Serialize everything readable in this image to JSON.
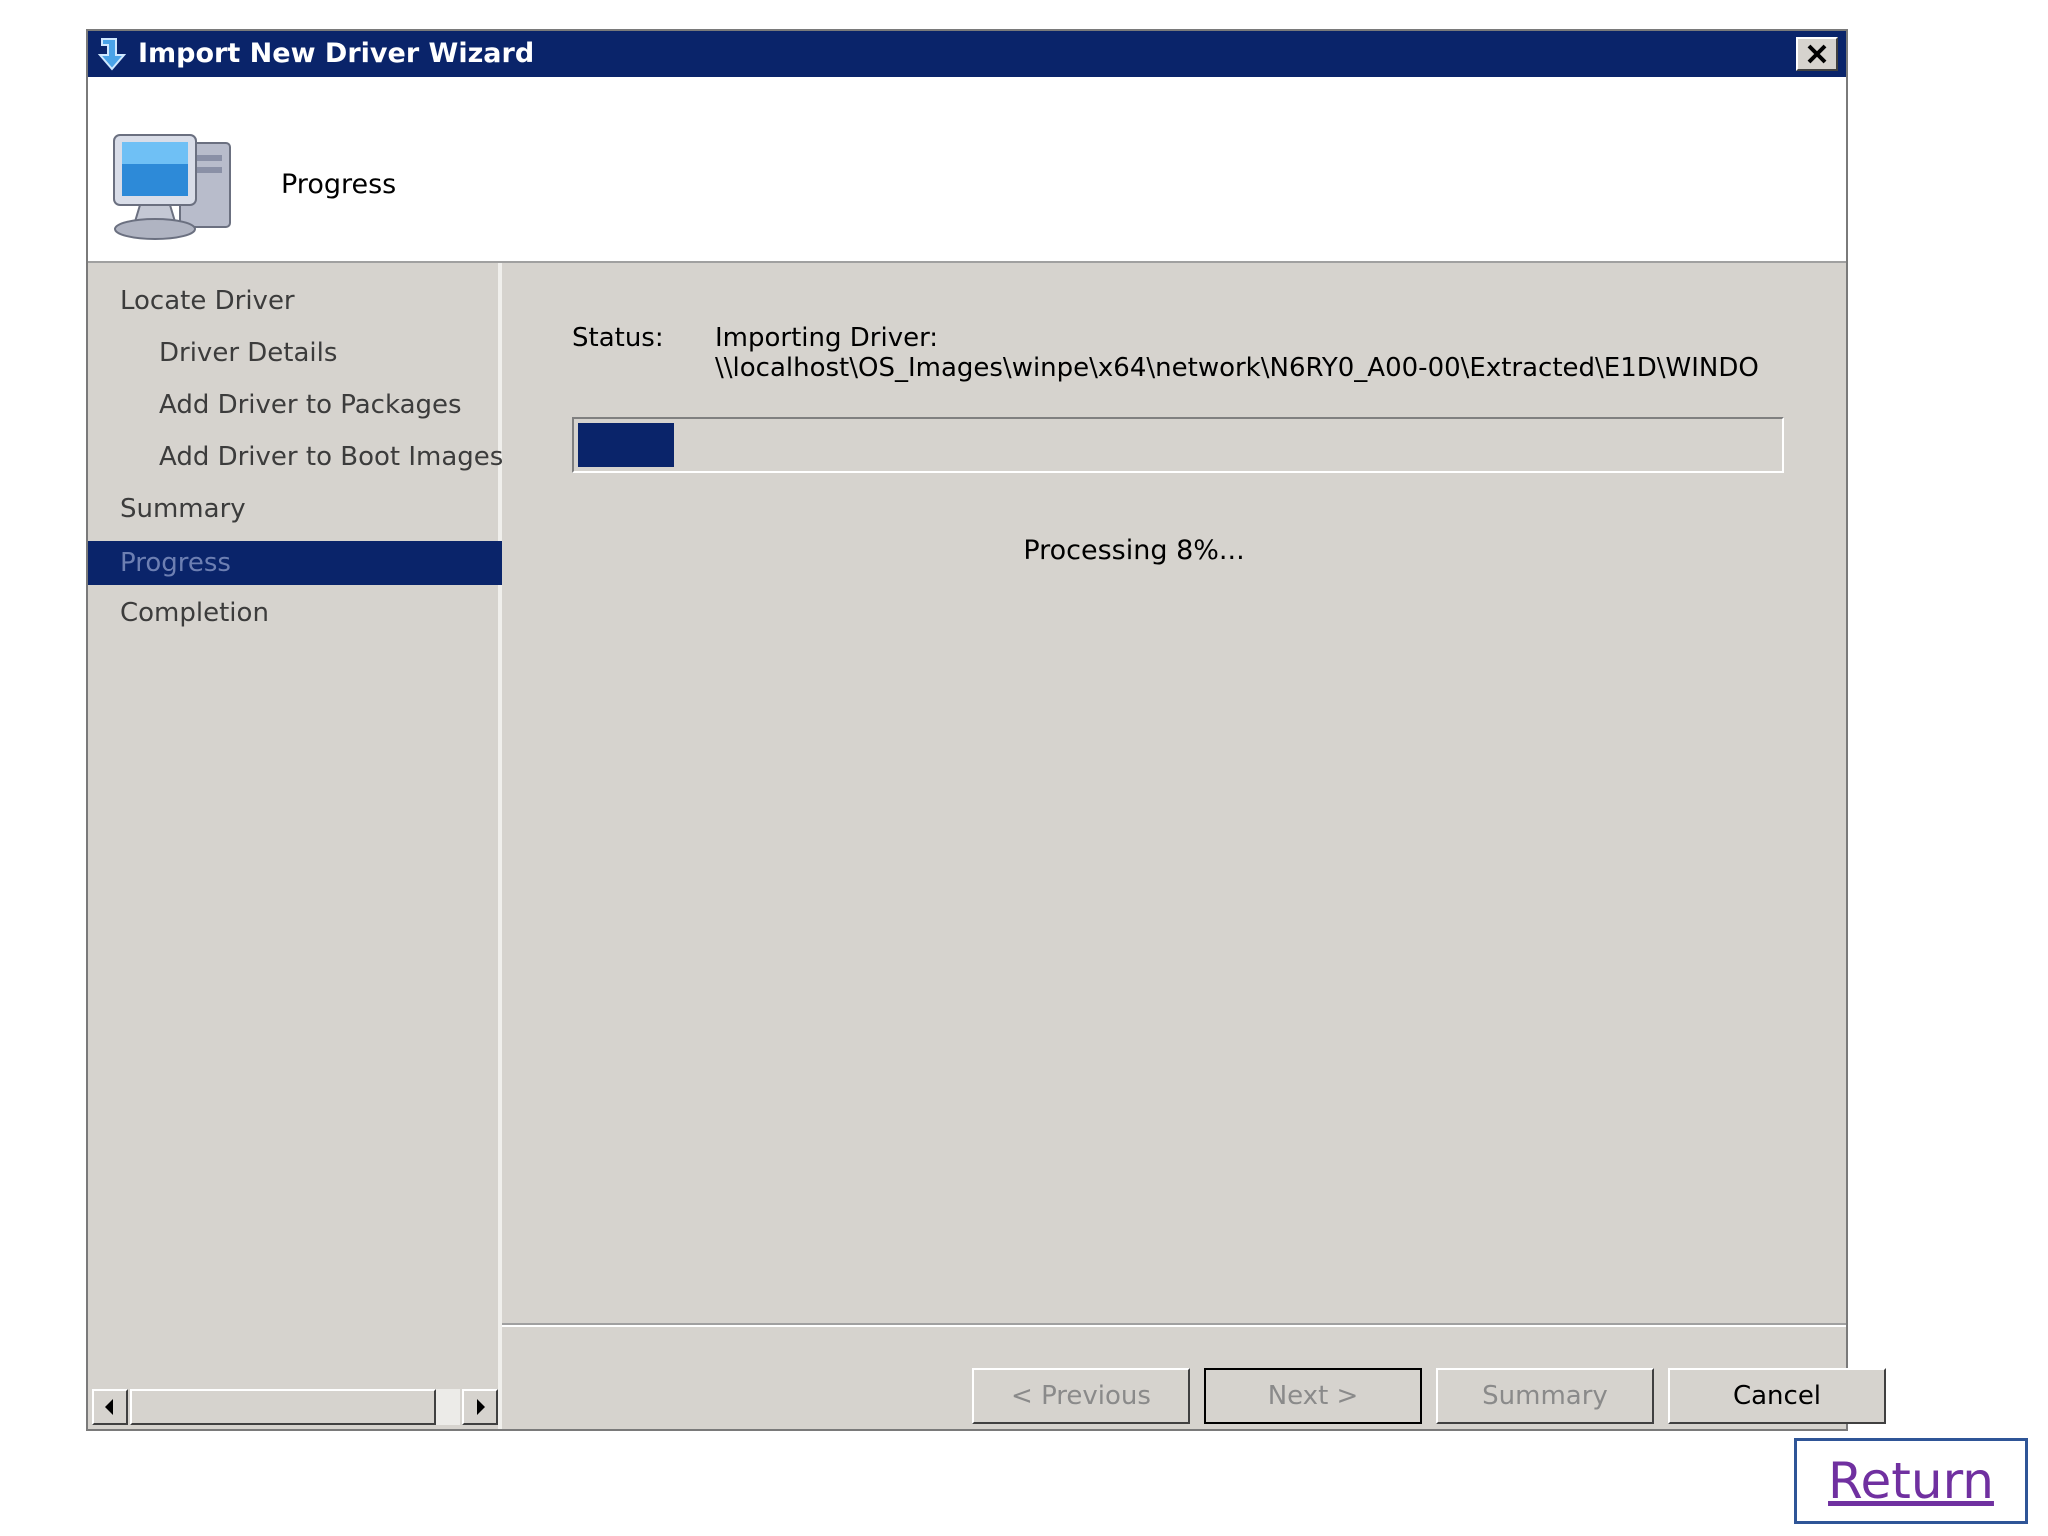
{
  "window": {
    "title": "Import New Driver Wizard",
    "header_title": "Progress"
  },
  "sidebar": {
    "items": [
      {
        "label": "Locate Driver",
        "indent": false,
        "active": false
      },
      {
        "label": "Driver Details",
        "indent": true,
        "active": false
      },
      {
        "label": "Add Driver to Packages",
        "indent": true,
        "active": false
      },
      {
        "label": "Add Driver to Boot Images",
        "indent": true,
        "active": false
      },
      {
        "label": "Summary",
        "indent": false,
        "active": false
      },
      {
        "label": "Progress",
        "indent": false,
        "active": true
      },
      {
        "label": "Completion",
        "indent": false,
        "active": false
      }
    ]
  },
  "content": {
    "status_label": "Status:",
    "status_line1": "Importing Driver:",
    "status_line2": "\\\\localhost\\OS_Images\\winpe\\x64\\network\\N6RY0_A00-00\\Extracted\\E1D\\WINDO",
    "progress_percent": 8,
    "processing_text": "Processing 8%..."
  },
  "buttons": {
    "previous": "< Previous",
    "next": "Next >",
    "summary": "Summary",
    "cancel": "Cancel"
  },
  "return_link": "Return",
  "colors": {
    "titlebar": "#0a246a",
    "dialog_bg": "#d6d3ce",
    "link": "#7030a0"
  }
}
